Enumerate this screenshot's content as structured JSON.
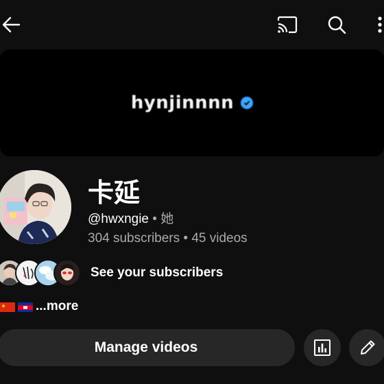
{
  "banner": {
    "text": "hynjinnnn"
  },
  "channel": {
    "name": "卡延",
    "handle": "@hwxngie",
    "pronoun": "她",
    "subscribers": "304 subscribers",
    "videos": "45 videos"
  },
  "see_subscribers_label": "See your subscribers",
  "more_label": "...more",
  "manage_videos_label": "Manage videos",
  "colors": {
    "background": "#0f0f0f",
    "button": "#272727",
    "verified": "#3ea6ff",
    "secondary_text": "#aaaaaa"
  },
  "icons": [
    "back-arrow-icon",
    "cast-icon",
    "search-icon",
    "more-vert-icon",
    "verified-icon",
    "analytics-icon",
    "edit-pencil-icon"
  ]
}
